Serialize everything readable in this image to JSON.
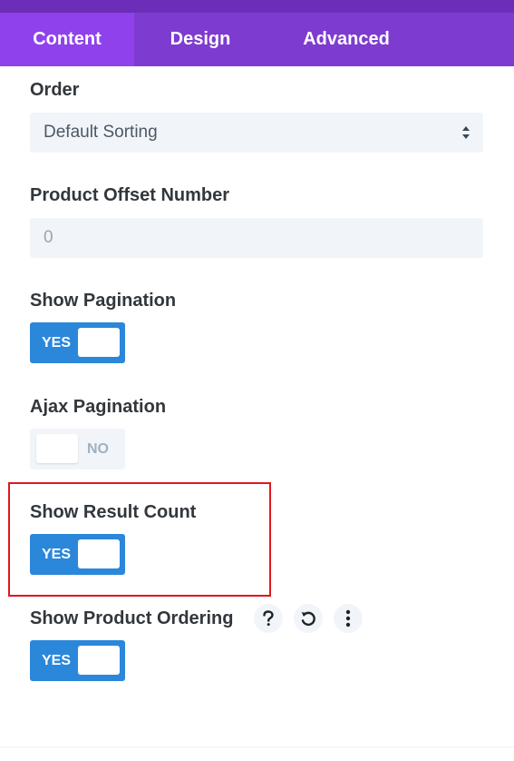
{
  "tabs": [
    {
      "label": "Content",
      "active": true
    },
    {
      "label": "Design",
      "active": false
    },
    {
      "label": "Advanced",
      "active": false
    }
  ],
  "fields": {
    "order": {
      "label": "Order",
      "value": "Default Sorting"
    },
    "offset": {
      "label": "Product Offset Number",
      "placeholder": "0"
    },
    "show_pagination": {
      "label": "Show Pagination",
      "state": "YES"
    },
    "ajax_pagination": {
      "label": "Ajax Pagination",
      "state": "NO"
    },
    "show_result_count": {
      "label": "Show Result Count",
      "state": "YES"
    },
    "show_product_ordering": {
      "label": "Show Product Ordering",
      "state": "YES"
    }
  },
  "icons": {
    "help": "help-icon",
    "reset": "reset-icon",
    "more": "more-options-icon"
  },
  "colors": {
    "tab_bar": "#7e3bd0",
    "tab_active": "#8f42ec",
    "toggle_on": "#2b87da",
    "toggle_off": "#f1f5f9",
    "highlight": "#e0171f"
  }
}
